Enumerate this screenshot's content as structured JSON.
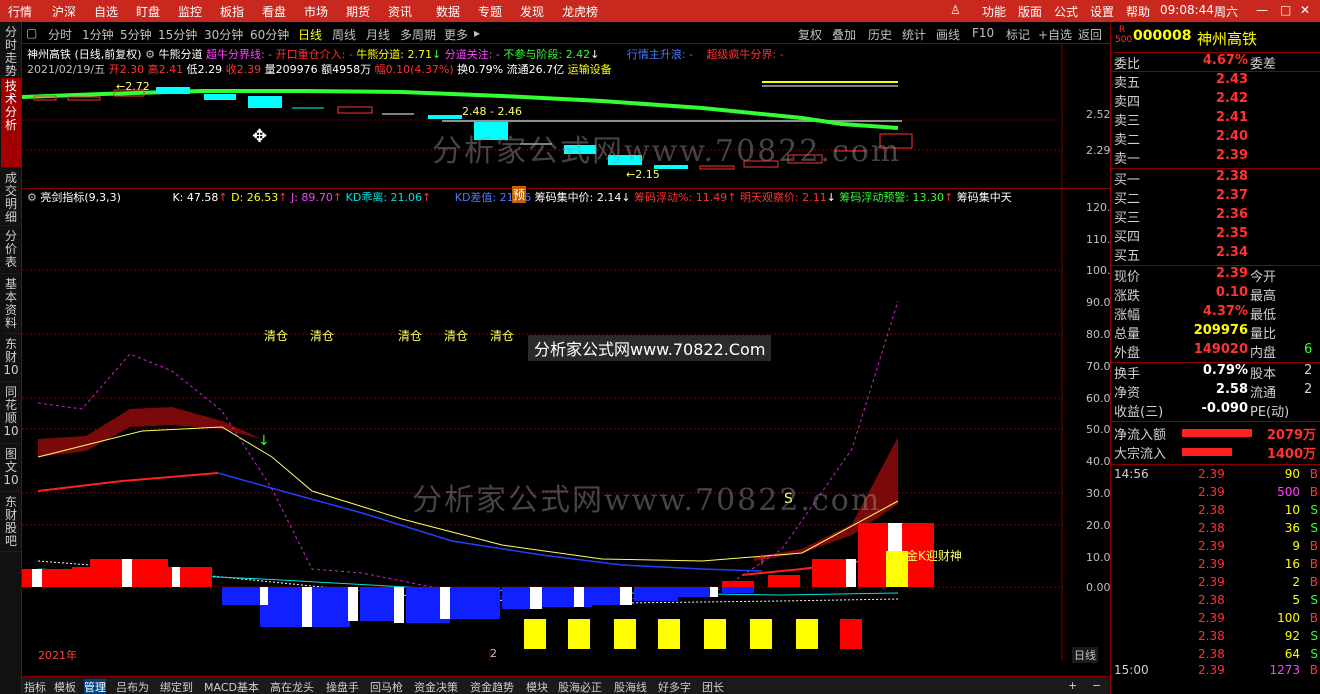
{
  "menu": {
    "items": [
      "行情",
      "沪深",
      "自选",
      "盯盘",
      "监控",
      "板指",
      "看盘",
      "市场",
      "期货",
      "资讯",
      "数据",
      "专题",
      "发现",
      "龙虎榜"
    ],
    "right": [
      "功能",
      "版面",
      "公式",
      "设置",
      "帮助"
    ],
    "time": "09:08:44",
    "weekday": "周六"
  },
  "left_tabs": [
    "分时走势",
    "技术分析",
    "成交明细",
    "分价表",
    "基本资料",
    "东财10",
    "同花顺10",
    "图文10",
    "东财股吧"
  ],
  "period_bar": {
    "items": [
      "分时",
      "1分钟",
      "5分钟",
      "15分钟",
      "30分钟",
      "60分钟",
      "日线",
      "周线",
      "月线",
      "多周期",
      "更多"
    ],
    "active": "日线",
    "right": [
      "复权",
      "叠加",
      "历史",
      "统计",
      "画线",
      "F10",
      "标记",
      "+自选",
      "返回"
    ]
  },
  "main_chart": {
    "line1": {
      "stock": "神州高铁",
      "mode": "(日线,前复权)",
      "ind": "牛熊分道",
      "f1": "超牛分界线: -",
      "f2": "开口重仓介入: -",
      "f3": "牛熊分道: 2.71",
      "f4": "分道关注: -",
      "f5": "不参与阶段: 2.42",
      "f6": "行情主升浪: -",
      "f7": "超级疯牛分界: -"
    },
    "line2": {
      "date": "2021/02/19/五",
      "open": "开2.30",
      "high": "高2.41",
      "low": "低2.29",
      "close": "收2.39",
      "vol": "量209976",
      "amt": "额4958万",
      "chg": "幅0.10(4.37%)",
      "turn": "换0.79%",
      "float": "流通26.7亿",
      "sector": "运输设备"
    },
    "labels": {
      "hi_marker": "2.72",
      "range": "2.48 - 2.46",
      "lo_marker": "2.15"
    },
    "y_labels": [
      "2.52",
      "2.29"
    ]
  },
  "indicator": {
    "name": "亮剑指标(9,3,3)",
    "k": "K: 47.58",
    "d": "D: 26.53",
    "j": "J: 89.70",
    "kd": "KD乖离: 21.06",
    "kdd": "KD差值: 21.06",
    "cm1": "筹码集中价: 2.14",
    "cm2": "筹码浮动%: 11.49",
    "cm3": "明天观察价: 2.11",
    "cm4": "筹码浮动预警: 13.30",
    "cm5": "筹码集中天",
    "y_labels": [
      "120.0",
      "110.0",
      "100.0",
      "90.00",
      "80.00",
      "70.00",
      "60.00",
      "50.00",
      "40.00",
      "30.00",
      "20.00",
      "10.00",
      "0.00"
    ],
    "clear_labels": [
      "清仓",
      "清仓",
      "清仓",
      "清仓",
      "清仓"
    ],
    "pre_label": "预",
    "god_label": "金K迎财神",
    "s_marker": "S",
    "banner": "分析家公式网www.70822.Com",
    "watermark": "分析家公式网www.70822.com",
    "x_labels": [
      "2021年",
      "2"
    ],
    "period": "日线"
  },
  "quote": {
    "badge": "R 500",
    "code": "000008",
    "name": "神州高铁",
    "weibi_label": "委比",
    "weibi": "4.67%",
    "weicha_label": "委差",
    "sells": [
      {
        "label": "卖五",
        "price": "2.43"
      },
      {
        "label": "卖四",
        "price": "2.42"
      },
      {
        "label": "卖三",
        "price": "2.41"
      },
      {
        "label": "卖二",
        "price": "2.40"
      },
      {
        "label": "卖一",
        "price": "2.39"
      }
    ],
    "buys": [
      {
        "label": "买一",
        "price": "2.38"
      },
      {
        "label": "买二",
        "price": "2.37"
      },
      {
        "label": "买三",
        "price": "2.36"
      },
      {
        "label": "买四",
        "price": "2.35"
      },
      {
        "label": "买五",
        "price": "2.34"
      }
    ],
    "stats": [
      {
        "k": "现价",
        "v": "2.39",
        "k2": "今开",
        "v2": ""
      },
      {
        "k": "涨跌",
        "v": "0.10",
        "k2": "最高",
        "v2": ""
      },
      {
        "k": "涨幅",
        "v": "4.37%",
        "k2": "最低",
        "v2": ""
      },
      {
        "k": "总量",
        "v": "209976",
        "k2": "量比",
        "v2": ""
      },
      {
        "k": "外盘",
        "v": "149020",
        "k2": "内盘",
        "v2": "6"
      }
    ],
    "stats2": [
      {
        "k": "换手",
        "v": "0.79%",
        "k2": "股本",
        "v2": "2"
      },
      {
        "k": "净资",
        "v": "2.58",
        "k2": "流通",
        "v2": "2"
      },
      {
        "k": "收益(三)",
        "v": "-0.090",
        "k2": "PE(动)",
        "v2": ""
      }
    ],
    "flow": [
      {
        "k": "净流入额",
        "v": "2079万"
      },
      {
        "k": "大宗流入",
        "v": "1400万"
      }
    ],
    "ticks": [
      {
        "t": "14:56",
        "p": "2.39",
        "vol": "90",
        "bs": "B"
      },
      {
        "t": "",
        "p": "2.39",
        "vol": "500",
        "bs": "B"
      },
      {
        "t": "",
        "p": "2.38",
        "vol": "10",
        "bs": "S"
      },
      {
        "t": "",
        "p": "2.38",
        "vol": "36",
        "bs": "S"
      },
      {
        "t": "",
        "p": "2.39",
        "vol": "9",
        "bs": "B"
      },
      {
        "t": "",
        "p": "2.39",
        "vol": "16",
        "bs": "B"
      },
      {
        "t": "",
        "p": "2.39",
        "vol": "2",
        "bs": "B"
      },
      {
        "t": "",
        "p": "2.38",
        "vol": "5",
        "bs": "S"
      },
      {
        "t": "",
        "p": "2.39",
        "vol": "100",
        "bs": "B"
      },
      {
        "t": "",
        "p": "2.38",
        "vol": "92",
        "bs": "S"
      },
      {
        "t": "",
        "p": "2.38",
        "vol": "64",
        "bs": "S"
      },
      {
        "t": "15:00",
        "p": "2.39",
        "vol": "1273",
        "bs": "B"
      }
    ]
  },
  "bottom_tabs": [
    "指标",
    "模板",
    "管理",
    "吕布为",
    "绑定到",
    "MACD基本",
    "高在龙头",
    "操盘手",
    "回马枪",
    "资金决策",
    "资金趋势",
    "模块",
    "股海必正",
    "股海线",
    "好多字",
    "团长"
  ],
  "bottom_active": "管理",
  "colors": {
    "menu_bg": "#c8281e",
    "up": "#ff3232",
    "down": "#00ffff",
    "grid": "#800000"
  }
}
